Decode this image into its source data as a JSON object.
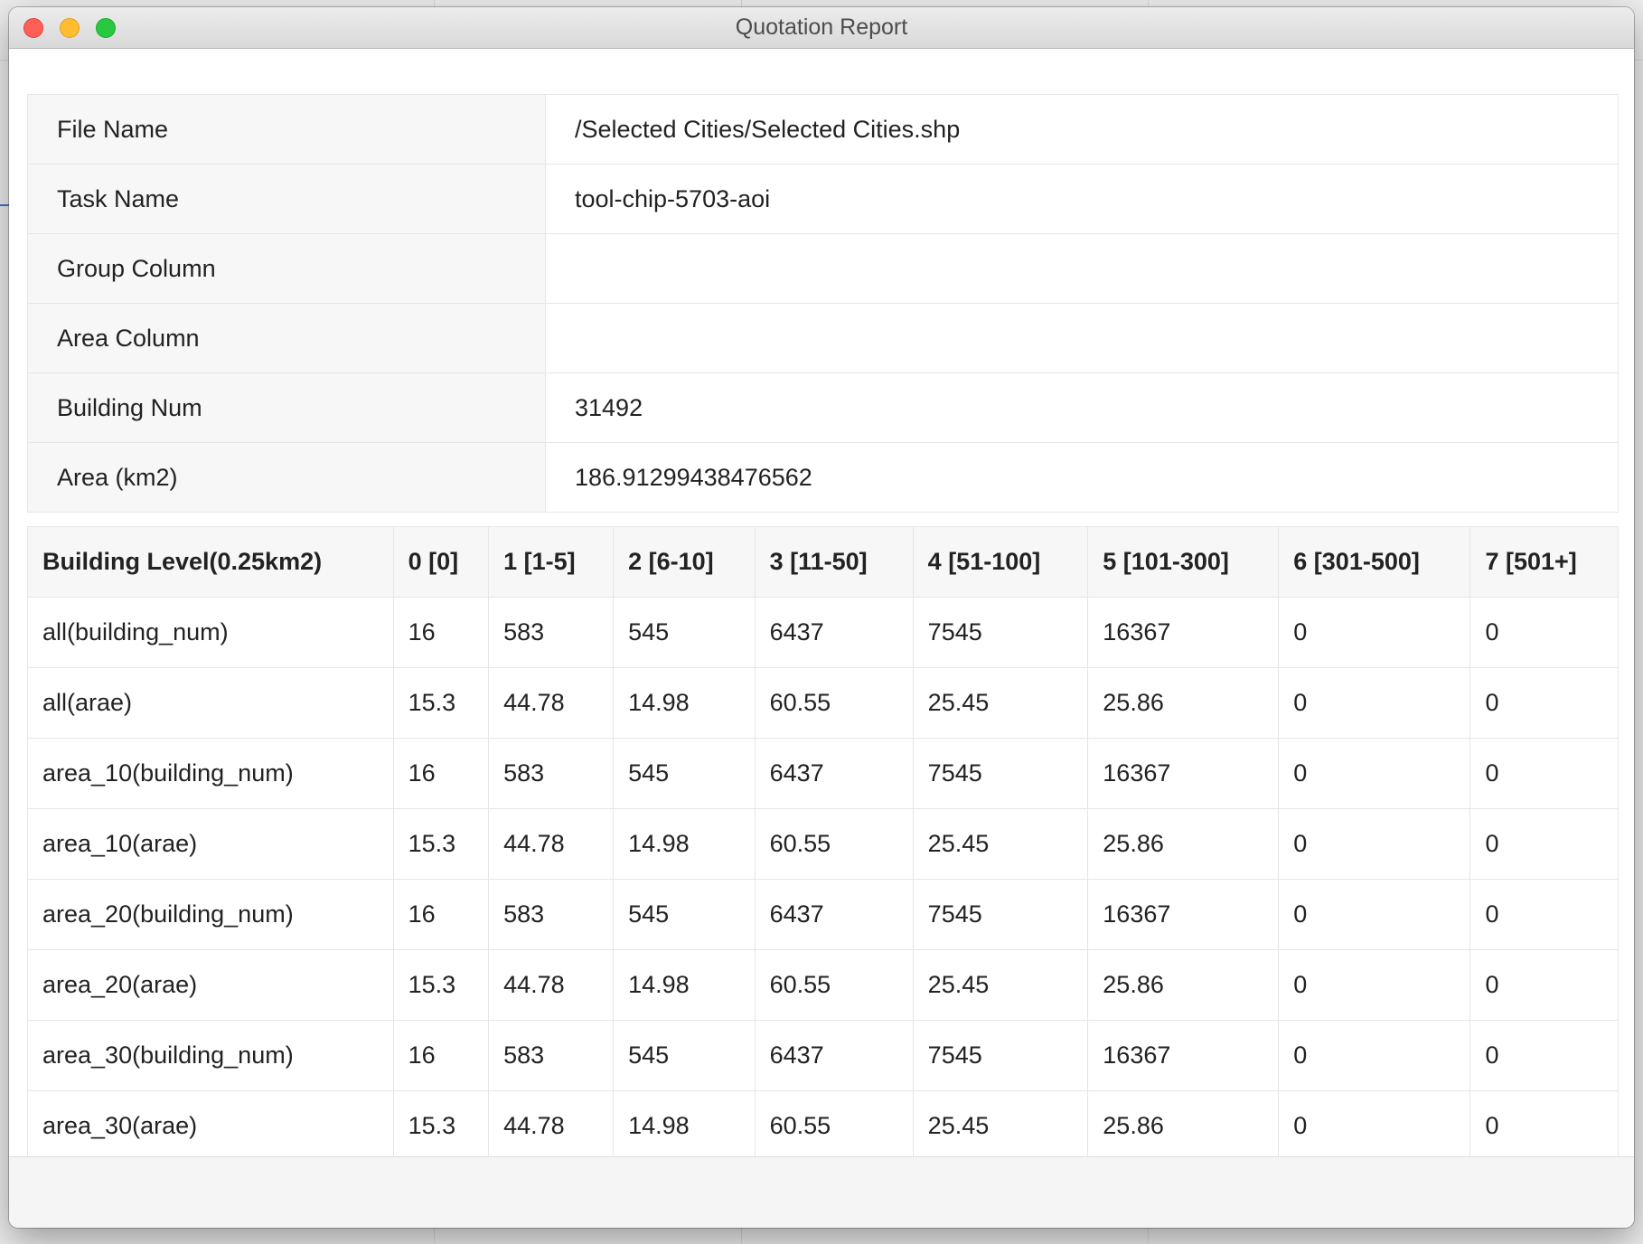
{
  "window": {
    "title": "Quotation Report"
  },
  "info": {
    "rows": [
      {
        "label": "File Name",
        "value": "/Selected Cities/Selected Cities.shp"
      },
      {
        "label": "Task Name",
        "value": "tool-chip-5703-aoi"
      },
      {
        "label": "Group Column",
        "value": ""
      },
      {
        "label": "Area Column",
        "value": ""
      },
      {
        "label": "Building Num",
        "value": "31492"
      },
      {
        "label": "Area (km2)",
        "value": "186.91299438476562"
      }
    ]
  },
  "levels": {
    "headers": [
      "Building Level(0.25km2)",
      "0 [0]",
      "1 [1-5]",
      "2 [6-10]",
      "3 [11-50]",
      "4 [51-100]",
      "5 [101-300]",
      "6 [301-500]",
      "7 [501+]"
    ],
    "rows": [
      [
        "all(building_num)",
        "16",
        "583",
        "545",
        "6437",
        "7545",
        "16367",
        "0",
        "0"
      ],
      [
        "all(arae)",
        "15.3",
        "44.78",
        "14.98",
        "60.55",
        "25.45",
        "25.86",
        "0",
        "0"
      ],
      [
        "area_10(building_num)",
        "16",
        "583",
        "545",
        "6437",
        "7545",
        "16367",
        "0",
        "0"
      ],
      [
        "area_10(arae)",
        "15.3",
        "44.78",
        "14.98",
        "60.55",
        "25.45",
        "25.86",
        "0",
        "0"
      ],
      [
        "area_20(building_num)",
        "16",
        "583",
        "545",
        "6437",
        "7545",
        "16367",
        "0",
        "0"
      ],
      [
        "area_20(arae)",
        "15.3",
        "44.78",
        "14.98",
        "60.55",
        "25.45",
        "25.86",
        "0",
        "0"
      ],
      [
        "area_30(building_num)",
        "16",
        "583",
        "545",
        "6437",
        "7545",
        "16367",
        "0",
        "0"
      ],
      [
        "area_30(arae)",
        "15.3",
        "44.78",
        "14.98",
        "60.55",
        "25.45",
        "25.86",
        "0",
        "0"
      ]
    ]
  },
  "colors": {
    "close": "#fe5f57",
    "minimize": "#febc2e",
    "maximize": "#28c840",
    "header_bg": "#f7f7f7",
    "border": "#e6e6e6"
  }
}
